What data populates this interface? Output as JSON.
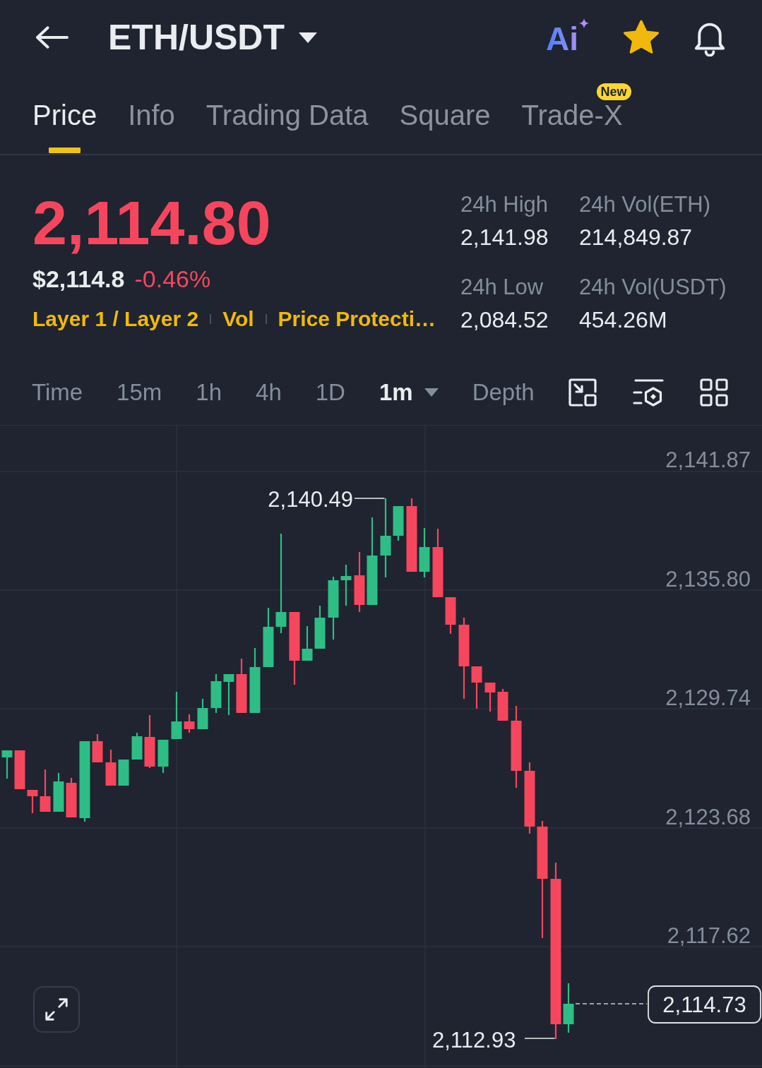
{
  "header": {
    "title": "ETH/USDT",
    "ai_label": "Ai",
    "favorite": true
  },
  "tabs": [
    {
      "label": "Price",
      "selected": true
    },
    {
      "label": "Info",
      "selected": false
    },
    {
      "label": "Trading Data",
      "selected": false
    },
    {
      "label": "Square",
      "selected": false
    },
    {
      "label": "Trade-X",
      "selected": false,
      "badge": "New"
    }
  ],
  "ticker": {
    "last_price": "2,114.80",
    "falling": true,
    "fiat_price": "$2,114.8",
    "change": "-0.46%",
    "tags": [
      "Layer 1 / Layer 2",
      "Vol",
      "Price Protecti…"
    ]
  },
  "stats": [
    {
      "label": "24h High",
      "value": "2,141.98"
    },
    {
      "label": "24h Vol(ETH)",
      "value": "214,849.87"
    },
    {
      "label": "24h Low",
      "value": "2,084.52"
    },
    {
      "label": "24h Vol(USDT)",
      "value": "454.26M"
    }
  ],
  "chart_toolbar": {
    "options": [
      {
        "label": "Time",
        "kind": "option",
        "selected": false
      },
      {
        "label": "15m",
        "kind": "option",
        "selected": false
      },
      {
        "label": "1h",
        "kind": "option",
        "selected": false
      },
      {
        "label": "4h",
        "kind": "option",
        "selected": false
      },
      {
        "label": "1D",
        "kind": "option",
        "selected": false
      },
      {
        "label": "1m",
        "kind": "dropdown",
        "selected": true
      },
      {
        "label": "Depth",
        "kind": "option",
        "selected": false
      }
    ]
  },
  "chart": {
    "price_axis": [
      "2,141.87",
      "2,135.80",
      "2,129.74",
      "2,123.68",
      "2,117.62"
    ],
    "high_label": "2,140.49",
    "low_label": "2,112.93",
    "last_price_tag": "2,114.73"
  }
}
